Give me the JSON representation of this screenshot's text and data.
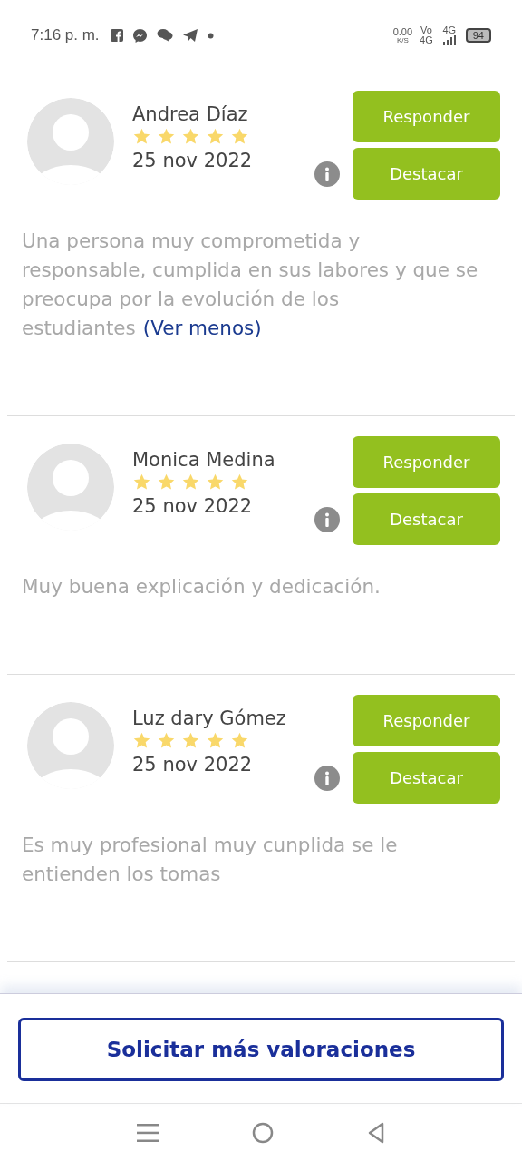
{
  "status_bar": {
    "time": "7:16 p. m.",
    "speed": "0.00",
    "speed_unit": "K/S",
    "volte_top": "Vo",
    "volte_bottom": "4G",
    "network": "4G",
    "battery": "94"
  },
  "reviews": [
    {
      "name": "Andrea Díaz",
      "stars": 5,
      "date": "25 nov 2022",
      "text": "Una persona muy comprometida y responsable, cumplida en sus labores y que se preocupa por la evolución de los estudiantes",
      "link": "(Ver menos)",
      "reply_button": "Responder",
      "highlight_button": "Destacar"
    },
    {
      "name": "Monica Medina",
      "stars": 5,
      "date": "25 nov 2022",
      "text": "Muy buena explicación y dedicación.",
      "reply_button": "Responder",
      "highlight_button": "Destacar"
    },
    {
      "name": "Luz dary Gómez",
      "stars": 5,
      "date": "25 nov 2022",
      "text": "Es muy profesional muy cunplida se le entienden los tomas",
      "reply_button": "Responder",
      "highlight_button": "Destacar"
    }
  ],
  "footer_button": "Solicitar más valoraciones"
}
